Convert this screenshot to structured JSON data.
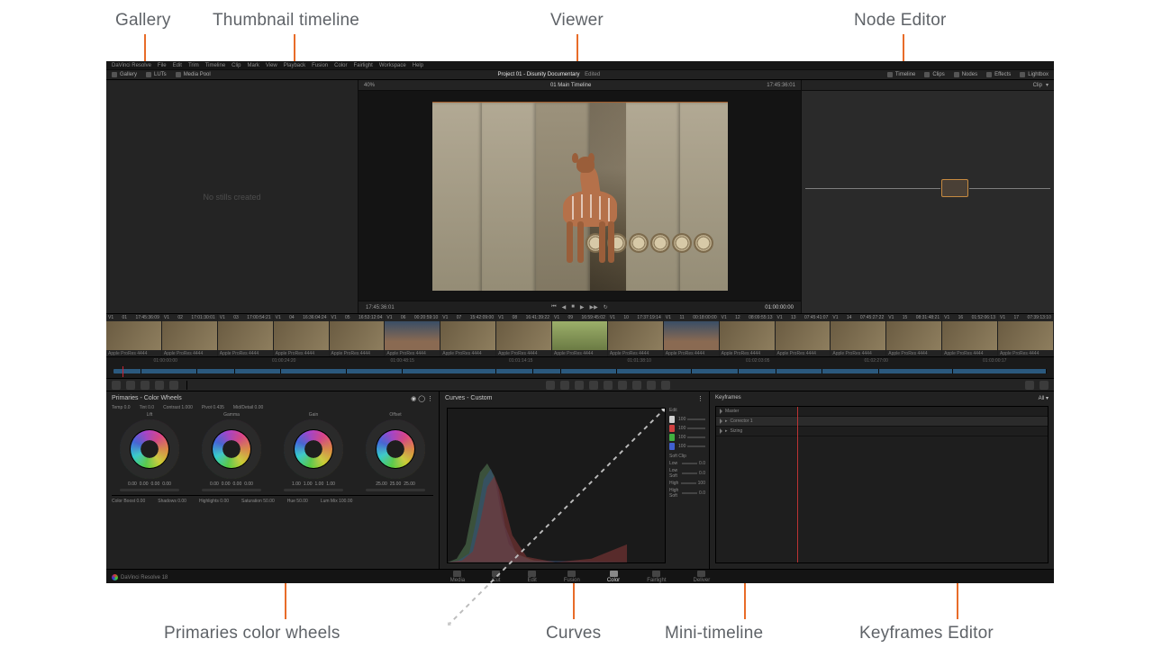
{
  "annotations": {
    "gallery": "Gallery",
    "thumb_timeline": "Thumbnail timeline",
    "viewer": "Viewer",
    "node_editor": "Node Editor",
    "primaries": "Primaries color wheels",
    "curves": "Curves",
    "mini_timeline": "Mini-timeline",
    "keyframes": "Keyframes Editor"
  },
  "menu": [
    "DaVinci Resolve",
    "File",
    "Edit",
    "Trim",
    "Timeline",
    "Clip",
    "Mark",
    "View",
    "Playback",
    "Fusion",
    "Color",
    "Fairlight",
    "Workspace",
    "Help"
  ],
  "toprow": {
    "left": [
      "Gallery",
      "LUTs",
      "Media Pool"
    ],
    "title": "Project 01 - Disunity Documentary",
    "status": "Edited",
    "right": [
      "Timeline",
      "Clips",
      "Nodes",
      "Effects",
      "Lightbox"
    ]
  },
  "viewer": {
    "zoom": "40%",
    "clip_name": "01 Main Timeline",
    "tc_left": "17:45:36:01",
    "tc_right": "01:00:00:00",
    "head_tc": "17:45:36:01"
  },
  "gallery": {
    "placeholder": "No stills created"
  },
  "nodes": {
    "dropdown": "Clip"
  },
  "thumbs": [
    {
      "n": "01",
      "tc": "17:45:36:09",
      "v": "V1"
    },
    {
      "n": "02",
      "tc": "17:01:30:01",
      "v": "V1"
    },
    {
      "n": "03",
      "tc": "17:00:54:21",
      "v": "V1"
    },
    {
      "n": "04",
      "tc": "16:36:04:24",
      "v": "V1"
    },
    {
      "n": "05",
      "tc": "16:53:12:04",
      "v": "V1"
    },
    {
      "n": "06",
      "tc": "00:20:59:10",
      "v": "V1"
    },
    {
      "n": "07",
      "tc": "15:42:09:00",
      "v": "V1"
    },
    {
      "n": "08",
      "tc": "16:41:39:22",
      "v": "V1"
    },
    {
      "n": "09",
      "tc": "16:59:45:02",
      "v": "V1"
    },
    {
      "n": "10",
      "tc": "17:37:19:14",
      "v": "V1"
    },
    {
      "n": "11",
      "tc": "00:18:00:00",
      "v": "V1"
    },
    {
      "n": "12",
      "tc": "08:09:55:13",
      "v": "V1"
    },
    {
      "n": "13",
      "tc": "07:45:41:07",
      "v": "V1"
    },
    {
      "n": "14",
      "tc": "07:45:27:22",
      "v": "V1"
    },
    {
      "n": "15",
      "tc": "08:31:48:21",
      "v": "V1"
    },
    {
      "n": "16",
      "tc": "01:52:06:13",
      "v": "V1"
    },
    {
      "n": "17",
      "tc": "07:39:13:10",
      "v": "V1"
    }
  ],
  "thumb_footer": "Apple ProRes 4444",
  "mt_ticks": [
    "01:00:00:00",
    "01:00:24:20",
    "01:00:48:15",
    "01:01:14:15",
    "01:01:38:10",
    "01:02:03:05",
    "01:02:27:00",
    "01:03:00:17"
  ],
  "primaries": {
    "title": "Primaries - Color Wheels",
    "adjust": [
      {
        "label": "Temp",
        "value": "0.0"
      },
      {
        "label": "Tint",
        "value": "0.0"
      },
      {
        "label": "Contrast",
        "value": "1.000"
      },
      {
        "label": "Pivot",
        "value": "0.435"
      },
      {
        "label": "Mid/Detail",
        "value": "0.00"
      }
    ],
    "wheels": [
      {
        "label": "Lift",
        "vals": [
          "0.00",
          "0.00",
          "0.00",
          "0.00"
        ]
      },
      {
        "label": "Gamma",
        "vals": [
          "0.00",
          "0.00",
          "0.00",
          "0.00"
        ]
      },
      {
        "label": "Gain",
        "vals": [
          "1.00",
          "1.00",
          "1.00",
          "1.00"
        ]
      },
      {
        "label": "Offset",
        "vals": [
          "25.00",
          "25.00",
          "25.00"
        ]
      }
    ],
    "footer": [
      {
        "label": "Color Boost",
        "value": "0.00"
      },
      {
        "label": "Shadows",
        "value": "0.00"
      },
      {
        "label": "Highlights",
        "value": "0.00"
      },
      {
        "label": "Saturation",
        "value": "50.00"
      },
      {
        "label": "Hue",
        "value": "50.00"
      },
      {
        "label": "Lum Mix",
        "value": "100.00"
      }
    ]
  },
  "curves": {
    "title": "Curves - Custom",
    "edit_label": "Edit",
    "channels": [
      {
        "color": "#d0d0d0",
        "value": "100"
      },
      {
        "color": "#d04040",
        "value": "100"
      },
      {
        "color": "#40b040",
        "value": "100"
      },
      {
        "color": "#4060d0",
        "value": "100"
      }
    ],
    "soft_label": "Soft Clip",
    "softclip": [
      {
        "label": "Low",
        "value": "0.0"
      },
      {
        "label": "Low Soft",
        "value": "0.0"
      },
      {
        "label": "High",
        "value": "100"
      },
      {
        "label": "High Soft",
        "value": "0.0"
      }
    ]
  },
  "keyframes": {
    "title": "Keyframes",
    "mode": "All",
    "rows": [
      "Master",
      "Corrector 1",
      "Sizing"
    ]
  },
  "pagebar": [
    "Media",
    "Cut",
    "Edit",
    "Fusion",
    "Color",
    "Fairlight",
    "Deliver"
  ],
  "brand": "DaVinci Resolve 18"
}
